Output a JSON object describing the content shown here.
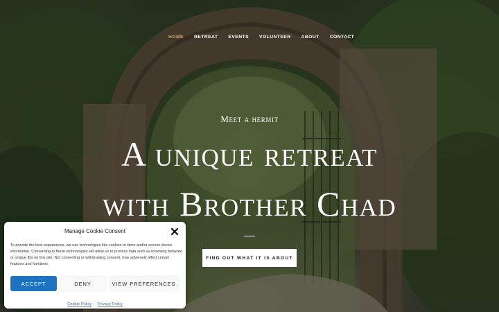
{
  "nav": {
    "items": [
      {
        "label": "HOME",
        "active": true
      },
      {
        "label": "RETREAT",
        "active": false
      },
      {
        "label": "EVENTS",
        "active": false
      },
      {
        "label": "VOLUNTEER",
        "active": false
      },
      {
        "label": "ABOUT",
        "active": false
      },
      {
        "label": "CONTACT",
        "active": false
      }
    ],
    "active_color": "#c9a57b"
  },
  "hero": {
    "eyebrow": "Meet a hermit",
    "headline_line1": "A unique retreat",
    "headline_line2": "with Brother Chad",
    "cta_label": "FIND OUT WHAT IT IS ABOUT",
    "background": "stone archway in forest"
  },
  "cookie": {
    "title": "Manage Cookie Consent",
    "close_icon": "close-icon",
    "text": "To provide the best experiences, we use technologies like cookies to store and/or access device information. Consenting to these technologies will allow us to process data such as browsing behavior or unique IDs on this site. Not consenting or withdrawing consent, may adversely affect certain features and functions.",
    "accept_label": "ACCEPT",
    "deny_label": "DENY",
    "preferences_label": "VIEW PREFERENCES",
    "cookie_policy_label": "Cookie Policy",
    "privacy_policy_label": "Privacy Policy",
    "accent_color": "#1e73be"
  }
}
